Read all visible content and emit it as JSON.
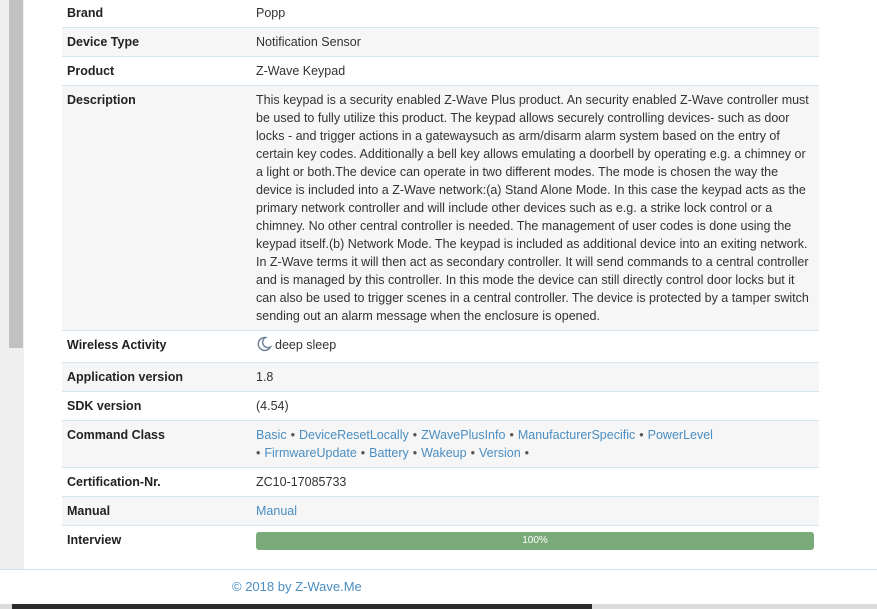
{
  "rows": {
    "brand": {
      "label": "Brand",
      "value": "Popp"
    },
    "device_type": {
      "label": "Device Type",
      "value": "Notification Sensor"
    },
    "product": {
      "label": "Product",
      "value": "Z-Wave Keypad"
    },
    "description": {
      "label": "Description",
      "value": "This keypad is a security enabled Z-Wave Plus product. An security enabled Z-Wave controller must be used to fully utilize this product. The keypad allows securely controlling devices- such as door locks - and trigger actions in a gatewaysuch as arm/disarm alarm system based on the entry of certain key codes. Additionally a bell key allows emulating a doorbell by operating e.g. a chimney or a light or both.The device can operate in two different modes. The mode is chosen the way the device is included into a Z-Wave network:(a) Stand Alone Mode. In this case the keypad acts as the primary network controller and will include other devices such as e.g. a strike lock control or a chimney. No other central controller is needed. The management of user codes is done using the keypad itself.(b) Network Mode. The keypad is included as additional device into an exiting network. In Z-Wave terms it will then act as secondary controller. It will send commands to a central controller and is managed by this controller. In this mode the device can still directly control door locks but it can also be used to trigger scenes in a central controller. The device is protected by a tamper switch sending out an alarm message when the enclosure is opened."
    },
    "wireless": {
      "label": "Wireless Activity",
      "value": "deep sleep",
      "icon": "moon-icon"
    },
    "app_version": {
      "label": "Application version",
      "value": "1.8"
    },
    "sdk_version": {
      "label": "SDK version",
      "value": "(4.54)"
    },
    "command_class": {
      "label": "Command Class",
      "items": [
        "Basic",
        "DeviceResetLocally",
        "ZWavePlusInfo",
        "ManufacturerSpecific",
        "PowerLevel",
        "FirmwareUpdate",
        "Battery",
        "Wakeup",
        "Version"
      ],
      "separator": "•"
    },
    "certification": {
      "label": "Certification-Nr.",
      "value": "ZC10-17085733"
    },
    "manual": {
      "label": "Manual",
      "value": "Manual"
    },
    "interview": {
      "label": "Interview",
      "value": "100%",
      "progress": 1.0
    }
  },
  "footer": {
    "text": "© 2018 by Z-Wave.Me"
  },
  "colors": {
    "link": "#4a8ec2",
    "progress": "#7aa97a",
    "divider": "#d6e6ee"
  }
}
